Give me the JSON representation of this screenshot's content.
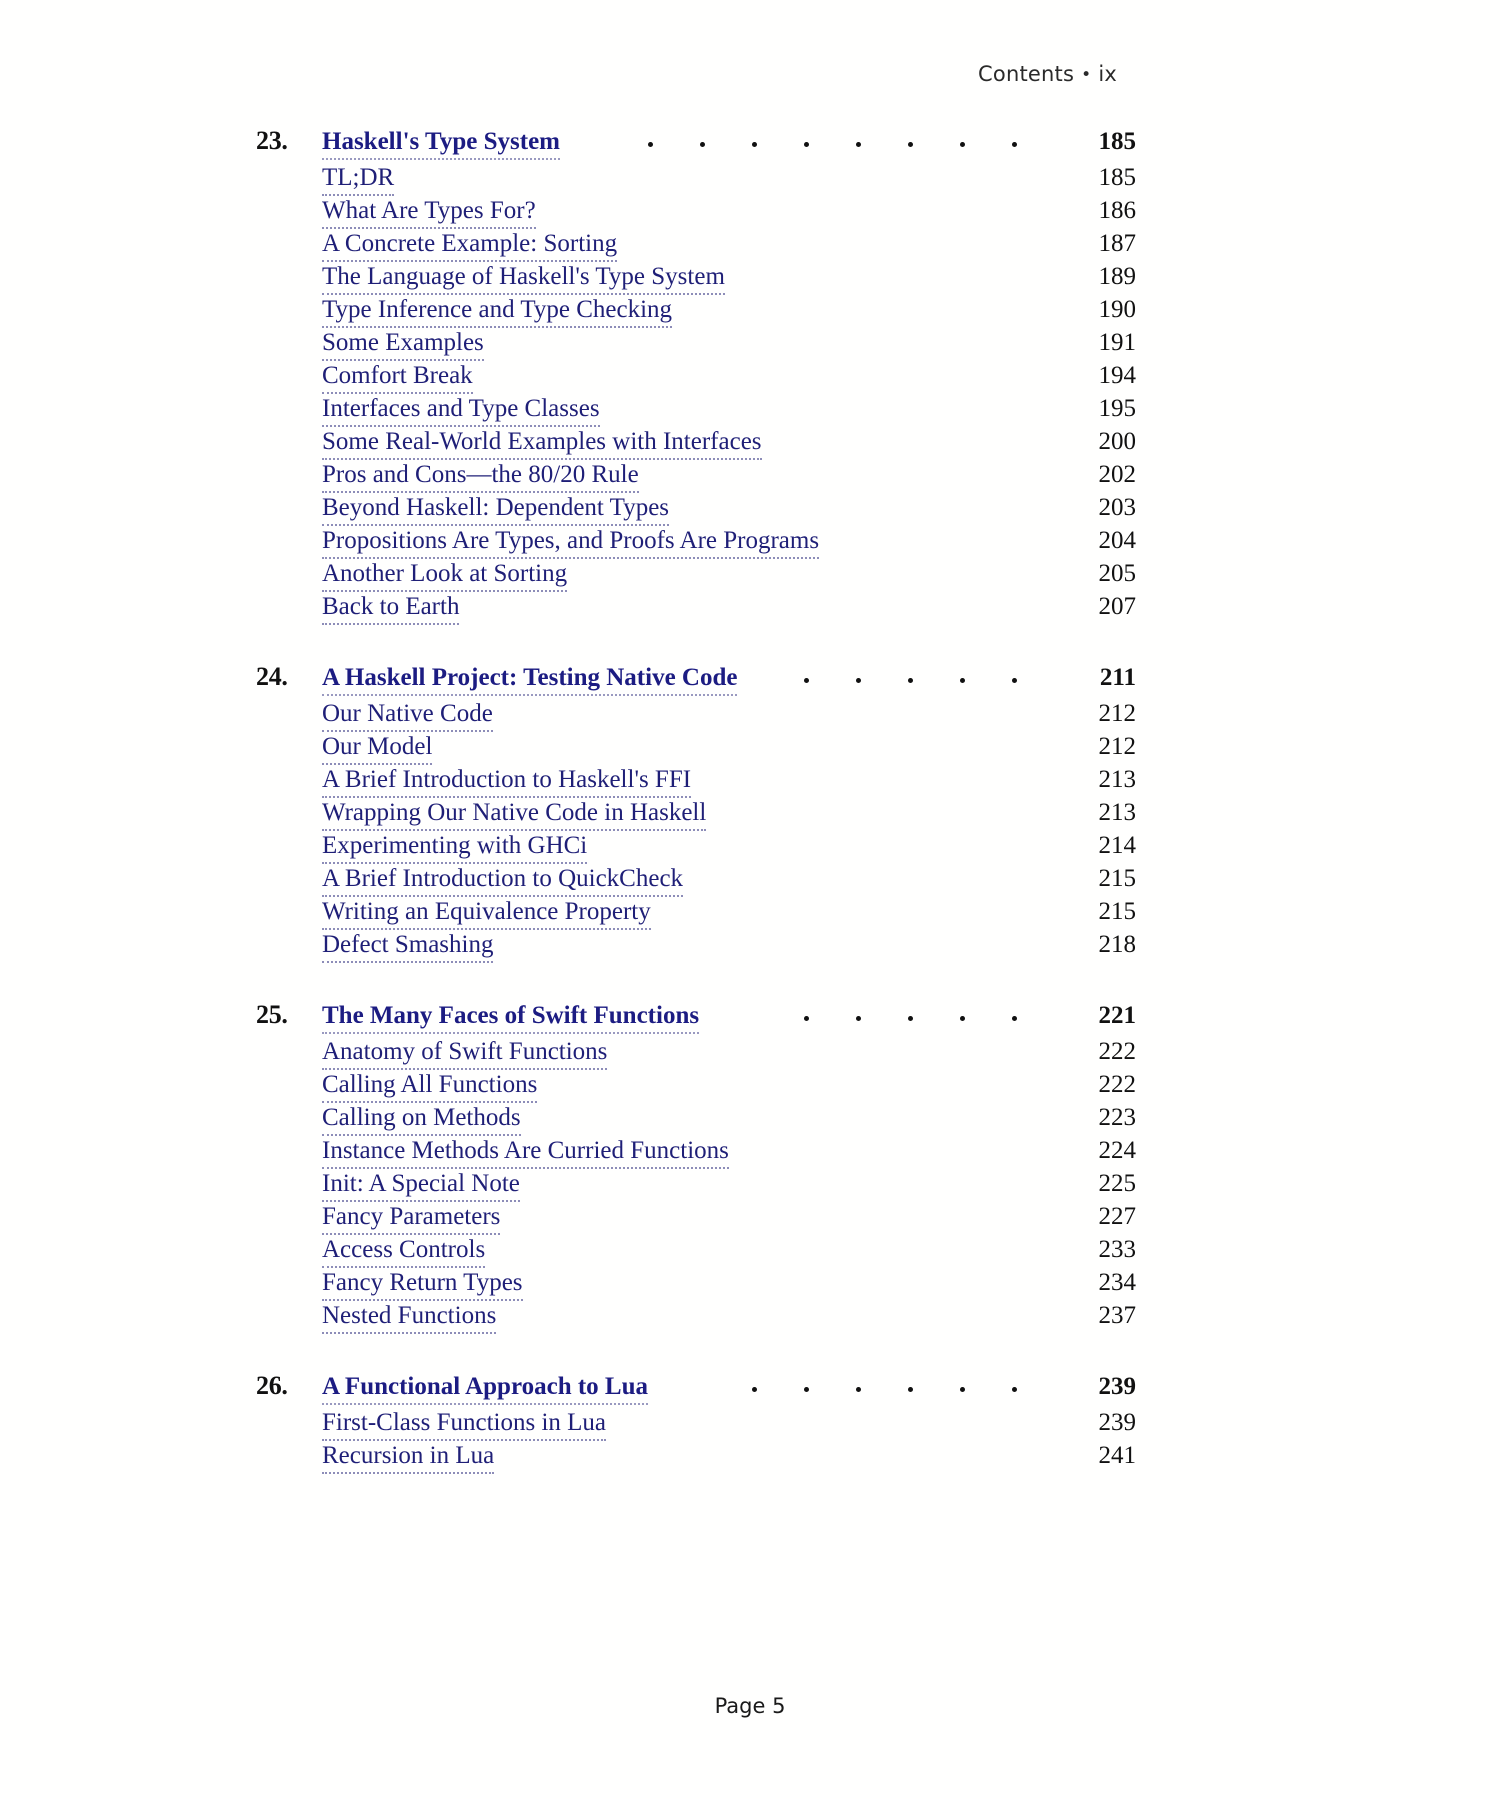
{
  "running_head": {
    "label": "Contents",
    "separator": "•",
    "folio": "ix"
  },
  "footer": {
    "label": "Page 5"
  },
  "colors": {
    "title_blue": "#1f1f77",
    "chapter_blue": "#1c1c82",
    "page_number": "#111111",
    "leader_dots": "#8d8db8",
    "background": "#ffffff"
  },
  "toc": {
    "chapters": [
      {
        "number": "23.",
        "title": "Haskell's Type System",
        "page": "185",
        "sections": [
          {
            "title": "TL;DR",
            "page": "185"
          },
          {
            "title": "What Are Types For?",
            "page": "186"
          },
          {
            "title": "A Concrete Example: Sorting",
            "page": "187"
          },
          {
            "title": "The Language of Haskell's Type System",
            "page": "189"
          },
          {
            "title": "Type Inference and Type Checking",
            "page": "190"
          },
          {
            "title": "Some Examples",
            "page": "191"
          },
          {
            "title": "Comfort Break",
            "page": "194"
          },
          {
            "title": "Interfaces and Type Classes",
            "page": "195"
          },
          {
            "title": "Some Real-World Examples with Interfaces",
            "page": "200"
          },
          {
            "title": "Pros and Cons—the 80/20 Rule",
            "page": "202"
          },
          {
            "title": "Beyond Haskell: Dependent Types",
            "page": "203"
          },
          {
            "title": "Propositions Are Types, and Proofs Are Programs",
            "page": "204"
          },
          {
            "title": "Another Look at Sorting",
            "page": "205"
          },
          {
            "title": "Back to Earth",
            "page": "207"
          }
        ]
      },
      {
        "number": "24.",
        "title": "A Haskell Project: Testing Native Code",
        "page": "211",
        "sections": [
          {
            "title": "Our Native Code",
            "page": "212"
          },
          {
            "title": "Our Model",
            "page": "212"
          },
          {
            "title": "A Brief Introduction to Haskell's FFI",
            "page": "213"
          },
          {
            "title": "Wrapping Our Native Code in Haskell",
            "page": "213"
          },
          {
            "title": "Experimenting with GHCi",
            "page": "214"
          },
          {
            "title": "A Brief Introduction to QuickCheck",
            "page": "215"
          },
          {
            "title": "Writing an Equivalence Property",
            "page": "215"
          },
          {
            "title": "Defect Smashing",
            "page": "218"
          }
        ]
      },
      {
        "number": "25.",
        "title": "The Many Faces of Swift Functions",
        "page": "221",
        "sections": [
          {
            "title": "Anatomy of Swift Functions",
            "page": "222"
          },
          {
            "title": "Calling All Functions",
            "page": "222"
          },
          {
            "title": "Calling on Methods",
            "page": "223"
          },
          {
            "title": "Instance Methods Are Curried Functions",
            "page": "224"
          },
          {
            "title": "Init: A Special Note",
            "page": "225"
          },
          {
            "title": "Fancy Parameters",
            "page": "227"
          },
          {
            "title": "Access Controls",
            "page": "233"
          },
          {
            "title": "Fancy Return Types",
            "page": "234"
          },
          {
            "title": "Nested Functions",
            "page": "237"
          }
        ]
      },
      {
        "number": "26.",
        "title": "A Functional Approach to Lua",
        "page": "239",
        "sections": [
          {
            "title": "First-Class Functions in Lua",
            "page": "239"
          },
          {
            "title": "Recursion in Lua",
            "page": "241"
          }
        ]
      }
    ]
  }
}
